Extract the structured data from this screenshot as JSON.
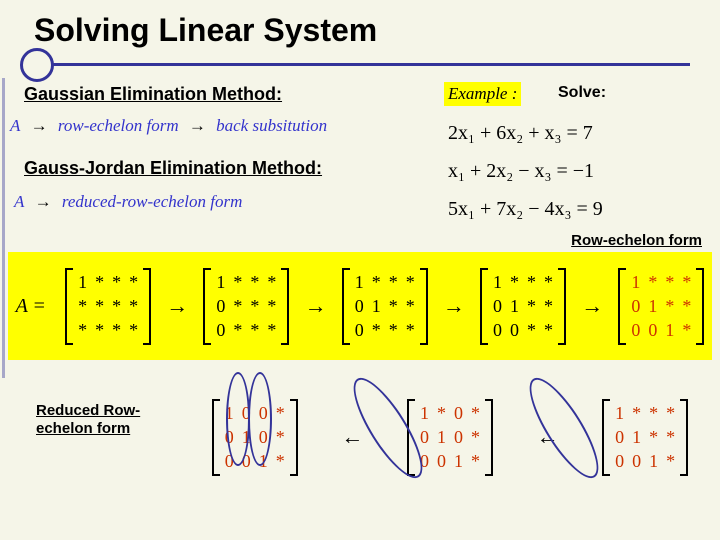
{
  "title": "Solving Linear System",
  "header1": "Gaussian Elimination Method:",
  "header2": "Gauss-Jordan  Elimination Method:",
  "example_tag": "Example :",
  "solve_label": "Solve:",
  "flow1_A": "A",
  "flow1_arrow": "→",
  "flow1_step1": "row-echelon form",
  "flow1_step2": "back subsitution",
  "flow2_A": "A",
  "flow2_arrow": "→",
  "flow2_step1": "reduced-row-echelon form",
  "eq1": "2x₁ + 6x₂ + x₃ = 7",
  "eq2": "x₁ + 2x₂ − x₃ = −1",
  "eq3": "5x₁ + 7x₂ − 4x₃ = 9",
  "row_echelon_label": "Row-echelon form",
  "reduced_label": "Reduced Row-echelon form",
  "arrow_right": "→",
  "arrow_left": "←",
  "matA_prefix": "A =",
  "seq": {
    "m1": [
      "1",
      "*",
      "*",
      "*",
      "*",
      "*",
      "*",
      "*",
      "*",
      "*",
      "*",
      "*"
    ],
    "m2": [
      "1",
      "*",
      "*",
      "*",
      "0",
      "*",
      "*",
      "*",
      "0",
      "*",
      "*",
      "*"
    ],
    "m3": [
      "1",
      "*",
      "*",
      "*",
      "0",
      "1",
      "*",
      "*",
      "0",
      "*",
      "*",
      "*"
    ],
    "m4": [
      "1",
      "*",
      "*",
      "*",
      "0",
      "1",
      "*",
      "*",
      "0",
      "0",
      "*",
      "*"
    ],
    "m5": [
      "1",
      "*",
      "*",
      "*",
      "0",
      "1",
      "*",
      "*",
      "0",
      "0",
      "1",
      "*"
    ]
  },
  "bot": {
    "m1": [
      "1",
      "0",
      "0",
      "*",
      "0",
      "1",
      "0",
      "*",
      "0",
      "0",
      "1",
      "*"
    ],
    "m2": [
      "1",
      "*",
      "0",
      "*",
      "0",
      "1",
      "0",
      "*",
      "0",
      "0",
      "1",
      "*"
    ],
    "m3": [
      "1",
      "*",
      "*",
      "*",
      "0",
      "1",
      "*",
      "*",
      "0",
      "0",
      "1",
      "*"
    ]
  }
}
